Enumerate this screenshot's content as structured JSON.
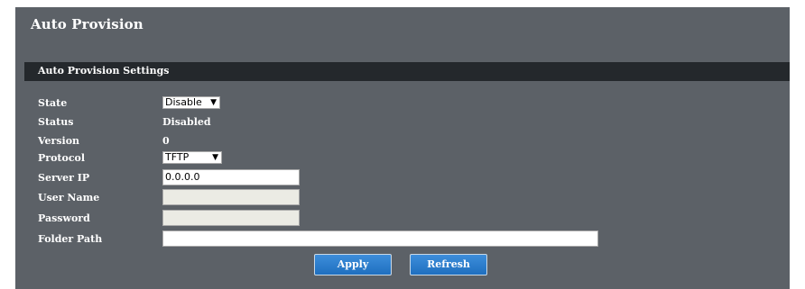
{
  "header": {
    "title": "Auto Provision"
  },
  "section": {
    "title": "Auto Provision Settings"
  },
  "form": {
    "state": {
      "label": "State",
      "value": "Disable",
      "caret": "▼"
    },
    "status": {
      "label": "Status",
      "value": "Disabled"
    },
    "version": {
      "label": "Version",
      "value": "0"
    },
    "protocol": {
      "label": "Protocol",
      "value": "TFTP",
      "caret": "▼"
    },
    "server_ip": {
      "label": "Server IP",
      "value": "0.0.0.0"
    },
    "user_name": {
      "label": "User Name",
      "value": ""
    },
    "password": {
      "label": "Password",
      "value": ""
    },
    "folder_path": {
      "label": "Folder Path",
      "value": ""
    }
  },
  "buttons": {
    "apply": "Apply",
    "refresh": "Refresh"
  },
  "colors": {
    "panel_bg": "#5c6167",
    "section_bar": "#24282c",
    "button_blue": "#2a7fd0"
  }
}
